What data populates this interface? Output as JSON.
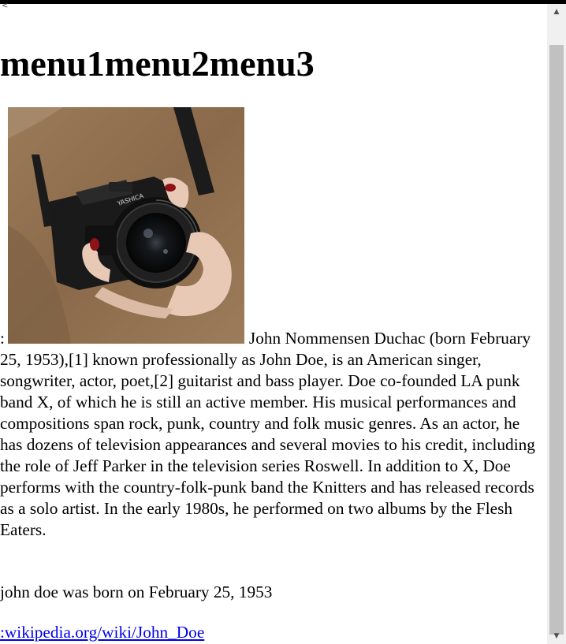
{
  "page": {
    "top_glyph": "<",
    "menu_heading": "menu1menu2menu3",
    "bio_prefix": ":",
    "bio_text": "John Nommensen Duchac (born February 25, 1953),[1] known professionally as John Doe, is an American singer, songwriter, actor, poet,[2] guitarist and bass player. Doe co-founded LA punk band X, of which he is still an active member. His musical performances and compositions span rock, punk, country and folk music genres. As an actor, he has dozens of television appearances and several movies to his credit, including the role of Jeff Parker in the television series Roswell. In addition to X, Doe performs with the country-folk-punk band the Knitters and has released records as a solo artist. In the early 1980s, he performed on two albums by the Flesh Eaters.",
    "birth_text": "john doe was born on February 25, 1953",
    "link_text": ":wikipedia.org/wiki/John_Doe",
    "photo_camera_brand": "YASHICA"
  },
  "scrollbar": {
    "up_icon": "▲",
    "down_icon": "▼"
  },
  "colors": {
    "link": "#0000ee",
    "topbar": "#000000",
    "scroll_track": "#f0f0f0",
    "scroll_thumb": "#c1c1c1"
  }
}
